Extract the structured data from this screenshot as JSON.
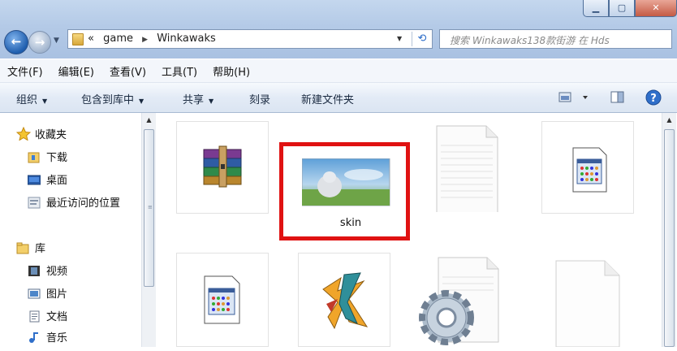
{
  "address_bar": {
    "prefix": "«",
    "crumbs": [
      "game",
      "Winkawaks"
    ]
  },
  "search": {
    "placeholder": "搜索 Winkawaks138款街游 在 Hds"
  },
  "menu": [
    "文件(F)",
    "编辑(E)",
    "查看(V)",
    "工具(T)",
    "帮助(H)"
  ],
  "toolbar": {
    "organize": "组织",
    "include_in_library": "包含到库中",
    "share": "共享",
    "burn": "刻录",
    "new_folder": "新建文件夹"
  },
  "sidebar": {
    "favorites_header": "收藏夹",
    "favorites": [
      "下载",
      "桌面",
      "最近访问的位置"
    ],
    "libraries_header": "库",
    "libraries": [
      "视频",
      "图片",
      "文档",
      "音乐"
    ]
  },
  "files": {
    "selected_label": "skin"
  },
  "icons": {
    "window_buttons": [
      "minimize-icon",
      "maximize-icon",
      "close-icon"
    ],
    "navigation": [
      "back-arrow-icon",
      "forward-arrow-icon",
      "refresh-icon"
    ],
    "toolbar": [
      "view-options-icon",
      "preview-pane-icon",
      "help-icon"
    ],
    "files": [
      "winrar-archive-icon",
      "skin-image-thumbnail",
      "text-document-icon",
      "system-file-icon",
      "system-file-icon",
      "winkawaks-app-icon",
      "config-file-gear-icon",
      "blank-document-icon"
    ]
  },
  "colors": {
    "highlight": "#e01212",
    "titlebar": "#b4cae7"
  }
}
